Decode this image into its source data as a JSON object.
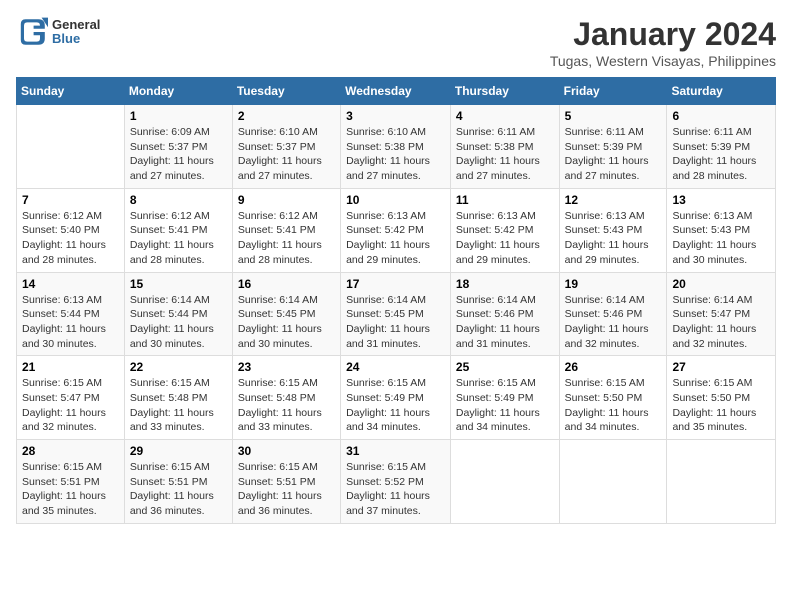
{
  "logo": {
    "general": "General",
    "blue": "Blue"
  },
  "header": {
    "title": "January 2024",
    "subtitle": "Tugas, Western Visayas, Philippines"
  },
  "weekdays": [
    "Sunday",
    "Monday",
    "Tuesday",
    "Wednesday",
    "Thursday",
    "Friday",
    "Saturday"
  ],
  "weeks": [
    [
      {
        "day": "",
        "info": ""
      },
      {
        "day": "1",
        "info": "Sunrise: 6:09 AM\nSunset: 5:37 PM\nDaylight: 11 hours\nand 27 minutes."
      },
      {
        "day": "2",
        "info": "Sunrise: 6:10 AM\nSunset: 5:37 PM\nDaylight: 11 hours\nand 27 minutes."
      },
      {
        "day": "3",
        "info": "Sunrise: 6:10 AM\nSunset: 5:38 PM\nDaylight: 11 hours\nand 27 minutes."
      },
      {
        "day": "4",
        "info": "Sunrise: 6:11 AM\nSunset: 5:38 PM\nDaylight: 11 hours\nand 27 minutes."
      },
      {
        "day": "5",
        "info": "Sunrise: 6:11 AM\nSunset: 5:39 PM\nDaylight: 11 hours\nand 27 minutes."
      },
      {
        "day": "6",
        "info": "Sunrise: 6:11 AM\nSunset: 5:39 PM\nDaylight: 11 hours\nand 28 minutes."
      }
    ],
    [
      {
        "day": "7",
        "info": "Sunrise: 6:12 AM\nSunset: 5:40 PM\nDaylight: 11 hours\nand 28 minutes."
      },
      {
        "day": "8",
        "info": "Sunrise: 6:12 AM\nSunset: 5:41 PM\nDaylight: 11 hours\nand 28 minutes."
      },
      {
        "day": "9",
        "info": "Sunrise: 6:12 AM\nSunset: 5:41 PM\nDaylight: 11 hours\nand 28 minutes."
      },
      {
        "day": "10",
        "info": "Sunrise: 6:13 AM\nSunset: 5:42 PM\nDaylight: 11 hours\nand 29 minutes."
      },
      {
        "day": "11",
        "info": "Sunrise: 6:13 AM\nSunset: 5:42 PM\nDaylight: 11 hours\nand 29 minutes."
      },
      {
        "day": "12",
        "info": "Sunrise: 6:13 AM\nSunset: 5:43 PM\nDaylight: 11 hours\nand 29 minutes."
      },
      {
        "day": "13",
        "info": "Sunrise: 6:13 AM\nSunset: 5:43 PM\nDaylight: 11 hours\nand 30 minutes."
      }
    ],
    [
      {
        "day": "14",
        "info": "Sunrise: 6:13 AM\nSunset: 5:44 PM\nDaylight: 11 hours\nand 30 minutes."
      },
      {
        "day": "15",
        "info": "Sunrise: 6:14 AM\nSunset: 5:44 PM\nDaylight: 11 hours\nand 30 minutes."
      },
      {
        "day": "16",
        "info": "Sunrise: 6:14 AM\nSunset: 5:45 PM\nDaylight: 11 hours\nand 30 minutes."
      },
      {
        "day": "17",
        "info": "Sunrise: 6:14 AM\nSunset: 5:45 PM\nDaylight: 11 hours\nand 31 minutes."
      },
      {
        "day": "18",
        "info": "Sunrise: 6:14 AM\nSunset: 5:46 PM\nDaylight: 11 hours\nand 31 minutes."
      },
      {
        "day": "19",
        "info": "Sunrise: 6:14 AM\nSunset: 5:46 PM\nDaylight: 11 hours\nand 32 minutes."
      },
      {
        "day": "20",
        "info": "Sunrise: 6:14 AM\nSunset: 5:47 PM\nDaylight: 11 hours\nand 32 minutes."
      }
    ],
    [
      {
        "day": "21",
        "info": "Sunrise: 6:15 AM\nSunset: 5:47 PM\nDaylight: 11 hours\nand 32 minutes."
      },
      {
        "day": "22",
        "info": "Sunrise: 6:15 AM\nSunset: 5:48 PM\nDaylight: 11 hours\nand 33 minutes."
      },
      {
        "day": "23",
        "info": "Sunrise: 6:15 AM\nSunset: 5:48 PM\nDaylight: 11 hours\nand 33 minutes."
      },
      {
        "day": "24",
        "info": "Sunrise: 6:15 AM\nSunset: 5:49 PM\nDaylight: 11 hours\nand 34 minutes."
      },
      {
        "day": "25",
        "info": "Sunrise: 6:15 AM\nSunset: 5:49 PM\nDaylight: 11 hours\nand 34 minutes."
      },
      {
        "day": "26",
        "info": "Sunrise: 6:15 AM\nSunset: 5:50 PM\nDaylight: 11 hours\nand 34 minutes."
      },
      {
        "day": "27",
        "info": "Sunrise: 6:15 AM\nSunset: 5:50 PM\nDaylight: 11 hours\nand 35 minutes."
      }
    ],
    [
      {
        "day": "28",
        "info": "Sunrise: 6:15 AM\nSunset: 5:51 PM\nDaylight: 11 hours\nand 35 minutes."
      },
      {
        "day": "29",
        "info": "Sunrise: 6:15 AM\nSunset: 5:51 PM\nDaylight: 11 hours\nand 36 minutes."
      },
      {
        "day": "30",
        "info": "Sunrise: 6:15 AM\nSunset: 5:51 PM\nDaylight: 11 hours\nand 36 minutes."
      },
      {
        "day": "31",
        "info": "Sunrise: 6:15 AM\nSunset: 5:52 PM\nDaylight: 11 hours\nand 37 minutes."
      },
      {
        "day": "",
        "info": ""
      },
      {
        "day": "",
        "info": ""
      },
      {
        "day": "",
        "info": ""
      }
    ]
  ]
}
